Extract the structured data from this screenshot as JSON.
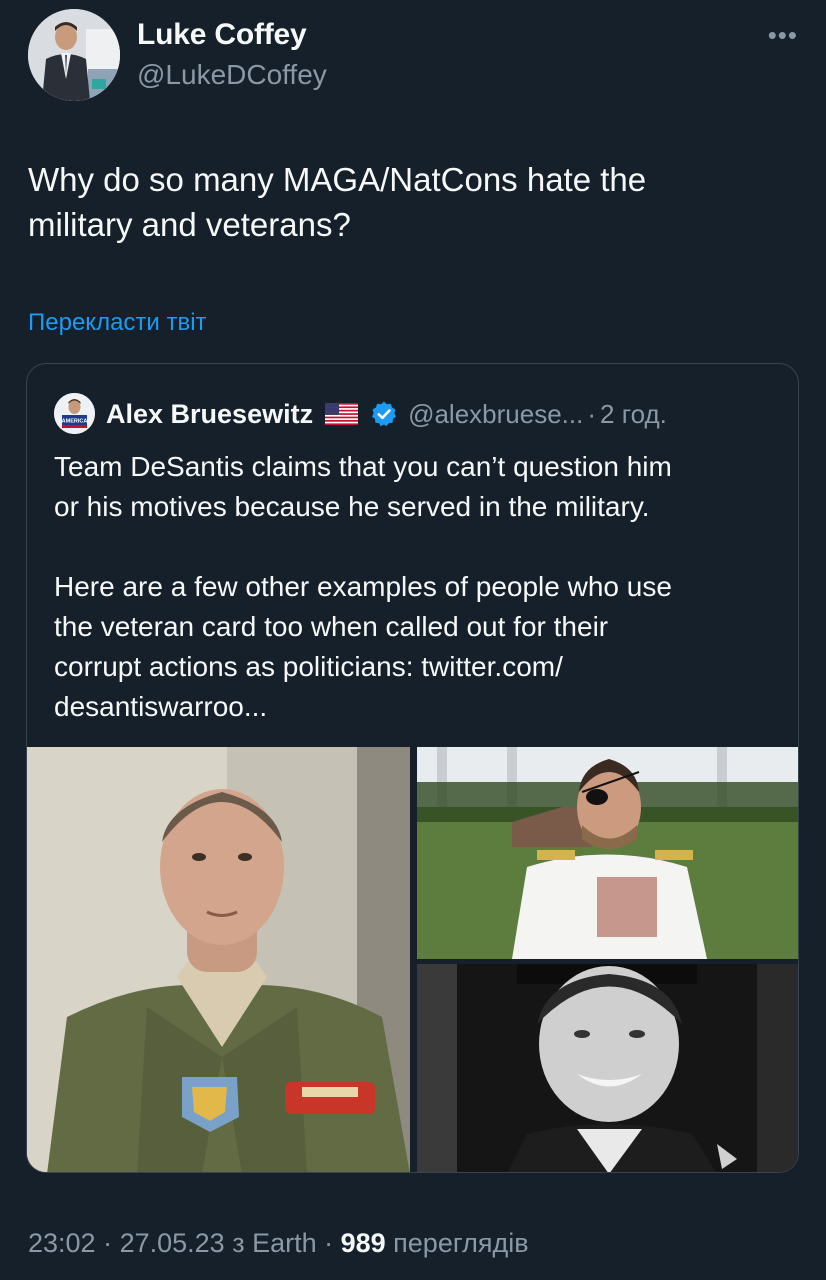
{
  "author": {
    "name": "Luke Coffey",
    "handle": "@LukeDCoffey"
  },
  "more_label": "•••",
  "tweet": {
    "text": "Why do so many MAGA/NatCons hate the\nmilitary and veterans?"
  },
  "translate_label": "Перекласти твіт",
  "quoted": {
    "name": "Alex Bruesewitz",
    "flag_icon": "us-flag-icon",
    "verified_icon": "verified-badge-icon",
    "handle": "@alexbruese...",
    "separator": "·",
    "time": "2 год.",
    "text": "Team DeSantis claims that you can’t question him\nor his motives because he served in the military.\n\nHere are a few other examples of people who use\nthe veteran card too when called out for their\ncorrupt actions as politicians: twitter.com/\ndesantiswarroo...",
    "avatar_text": "AMERICA"
  },
  "meta": {
    "time": "23:02",
    "sep1": " · ",
    "date": "27.05.23",
    "via": " з Earth",
    "sep2": " · ",
    "views": "989",
    "views_label": " переглядів"
  },
  "colors": {
    "background": "#15202b",
    "text": "#f7f9f9",
    "secondary": "#8b98a5",
    "accent": "#1d9bf0",
    "border": "#38444d"
  }
}
